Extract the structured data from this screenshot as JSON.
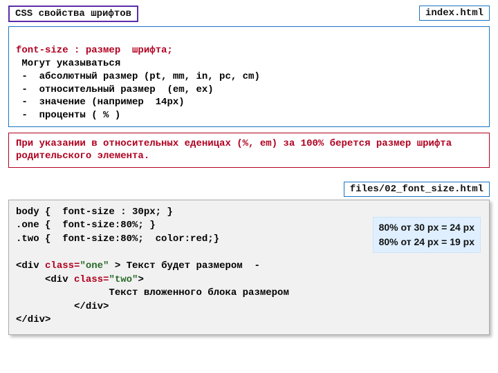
{
  "header": {
    "title": "CSS свойства шрифтов",
    "file1": "index.html"
  },
  "panel1": {
    "line1": "font-size : размер  шрифта;",
    "line2": " Могут указываться",
    "line3": " -  абсолютный размер (pt, mm, in, pc, cm)",
    "line4": " -  относительный размер  (em, ex)",
    "line5": " -  значение (например  14px)",
    "line6": " -  проценты ( % )"
  },
  "note": {
    "text": "При указании в относительных еденицах (%, em) за 100% берется размер шрифта родительского элемента."
  },
  "file2": "files/02_font_size.html",
  "code": {
    "l1": "body {  font-size : 30px; }",
    "l2": ".one {  font-size:80%; }",
    "l3": ".two {  font-size:80%;  color:red;}",
    "l4_a": "<div ",
    "l4_class": "class=",
    "l4_val": "\"one\"",
    "l4_b": " > Текст будет размером  -",
    "l5_a": "     <div ",
    "l5_class": "class=",
    "l5_val": "\"two\"",
    "l5_b": ">",
    "l6": "                Текст вложенного блока размером",
    "l7": "          </div>",
    "l8": "</div>"
  },
  "calc": {
    "line1": "80% от 30 px = 24 px",
    "line2": "80% от 24 px =  19 px"
  }
}
